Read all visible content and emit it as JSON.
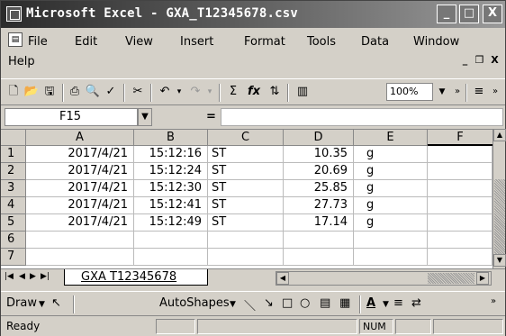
{
  "window": {
    "title": "Microsoft Excel - GXA_T12345678.csv",
    "buttons": {
      "minimize": "_",
      "maximize": "□",
      "close": "X"
    }
  },
  "menu": {
    "file": "File",
    "edit": "Edit",
    "view": "View",
    "insert": "Insert",
    "format": "Format",
    "tools": "Tools",
    "data": "Data",
    "window": "Window",
    "help": "Help"
  },
  "mdi_buttons": {
    "minimize": "_",
    "restore": "❐",
    "close": "X"
  },
  "toolbar": {
    "zoom": "100%"
  },
  "formula_bar": {
    "name_box": "F15",
    "equals": "=",
    "formula": ""
  },
  "grid": {
    "columns": [
      "A",
      "B",
      "C",
      "D",
      "E",
      "F"
    ],
    "row_numbers": [
      "1",
      "2",
      "3",
      "4",
      "5",
      "6",
      "7"
    ],
    "rows": [
      {
        "a": "2017/4/21",
        "b": "15:12:16",
        "c": "ST",
        "d": "10.35",
        "e": "g"
      },
      {
        "a": "2017/4/21",
        "b": "15:12:24",
        "c": "ST",
        "d": "20.69",
        "e": "g"
      },
      {
        "a": "2017/4/21",
        "b": "15:12:30",
        "c": "ST",
        "d": "25.85",
        "e": "g"
      },
      {
        "a": "2017/4/21",
        "b": "15:12:41",
        "c": "ST",
        "d": "27.73",
        "e": "g"
      },
      {
        "a": "2017/4/21",
        "b": "15:12:49",
        "c": "ST",
        "d": "17.14",
        "e": "g"
      }
    ]
  },
  "sheet_tab": "GXA T12345678",
  "drawing": {
    "draw": "Draw",
    "autoshapes": "AutoShapes"
  },
  "status": {
    "ready": "Ready",
    "num": "NUM"
  }
}
